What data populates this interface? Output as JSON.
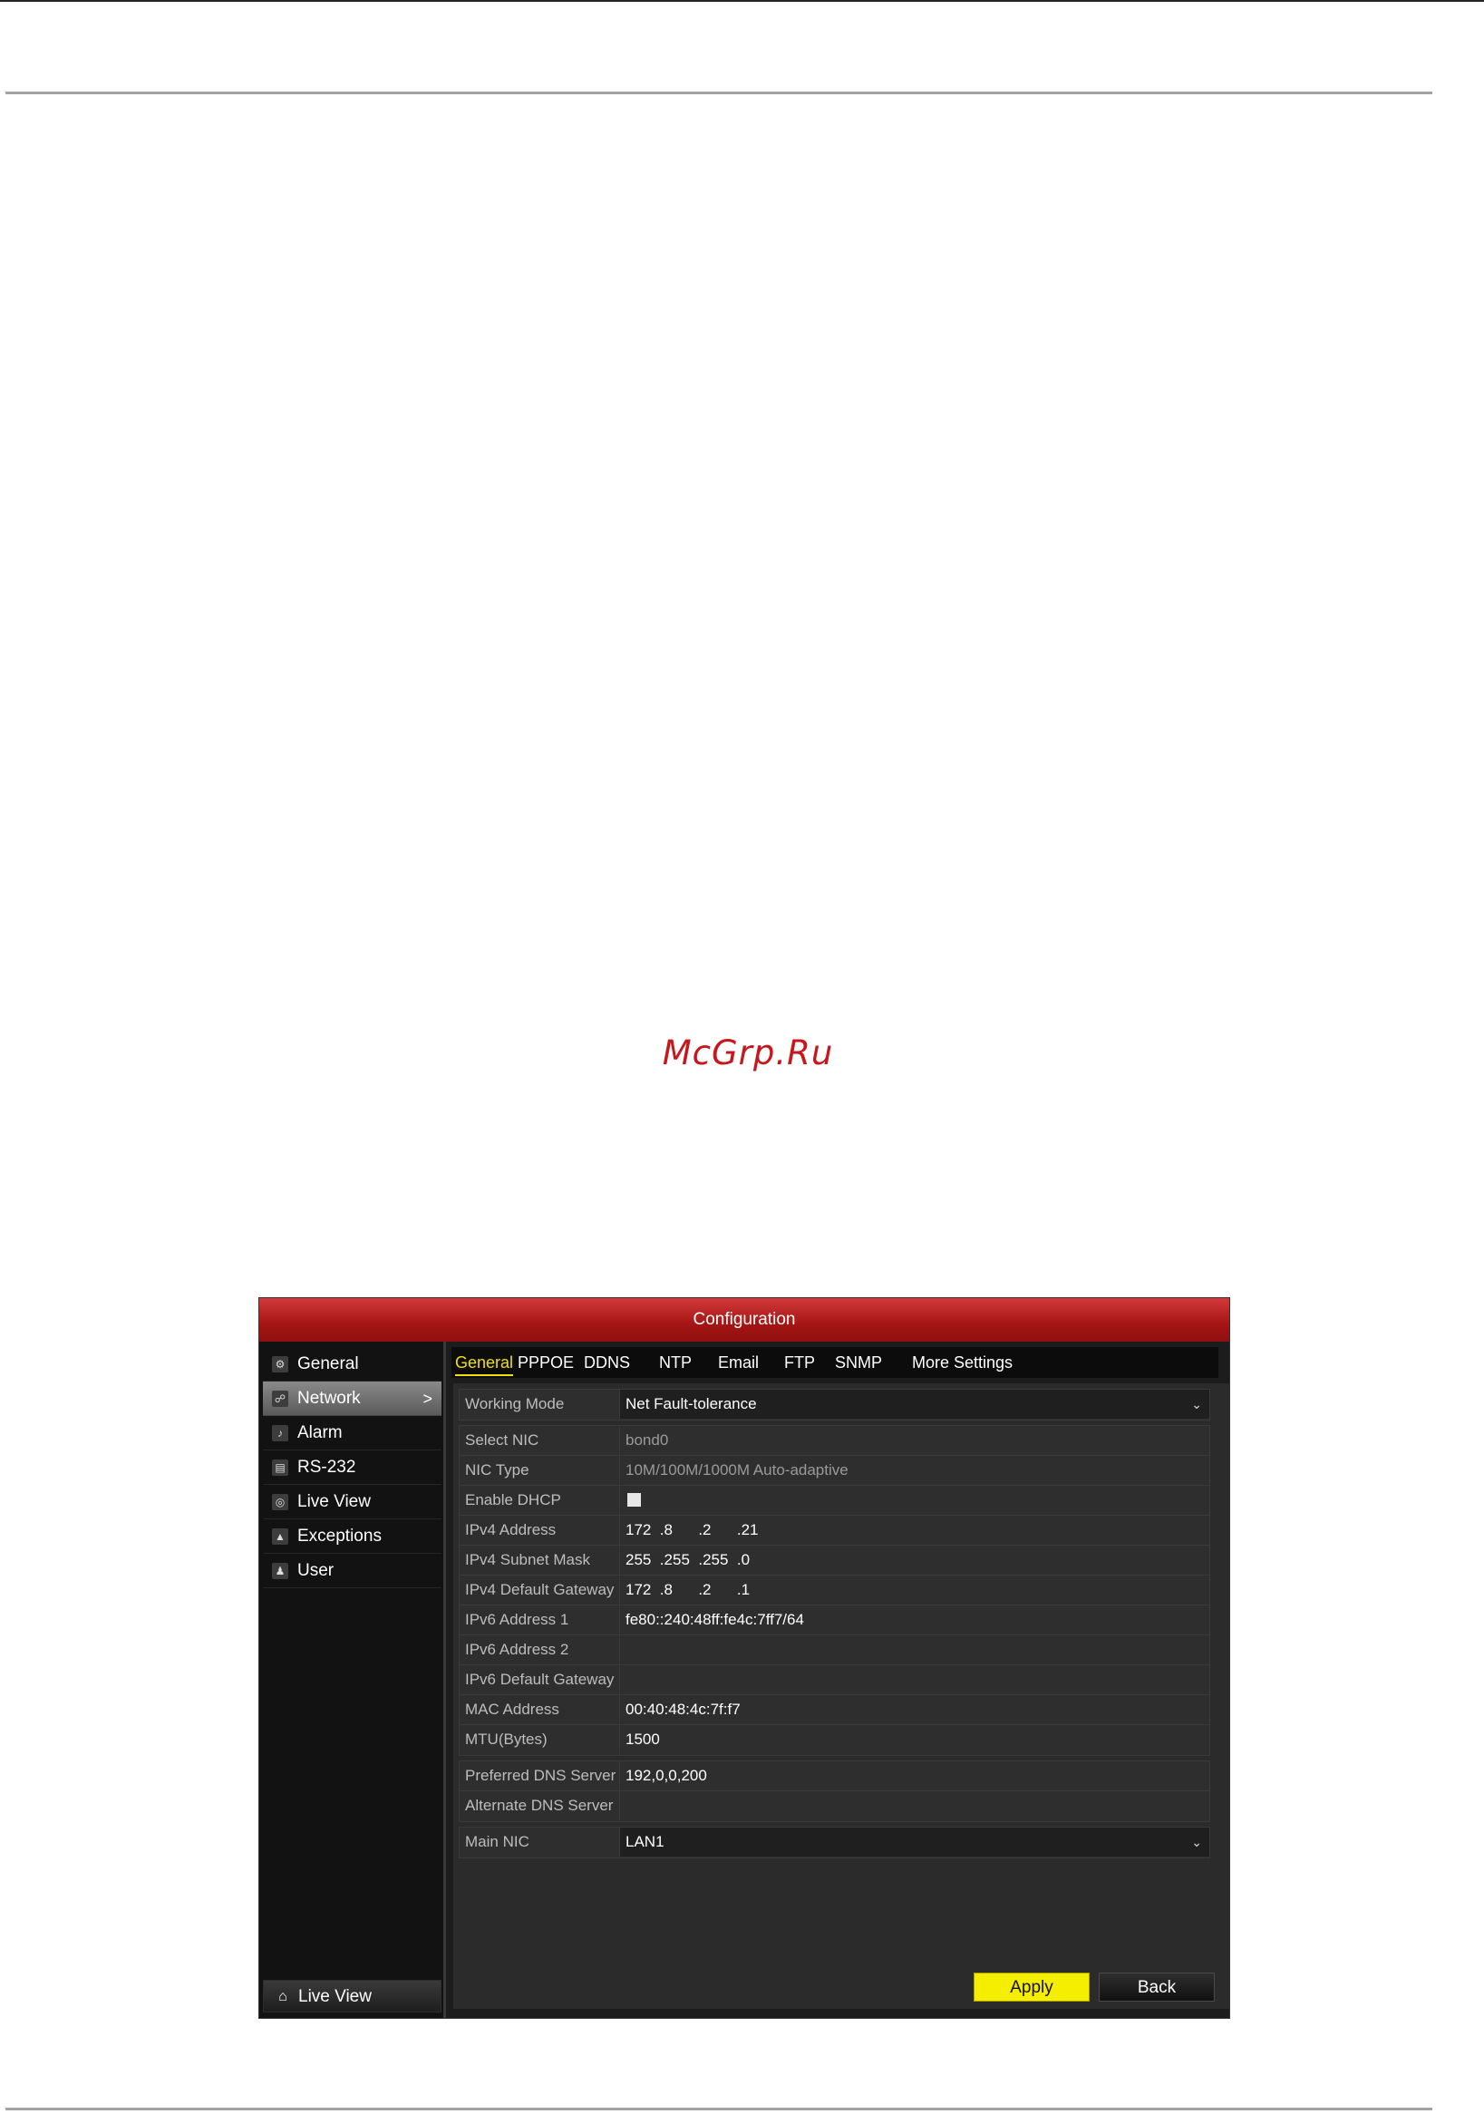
{
  "watermark": "McGrp.Ru",
  "window": {
    "title": "Configuration"
  },
  "sidebar": {
    "items": [
      {
        "label": "General",
        "icon": "gear-icon"
      },
      {
        "label": "Network",
        "icon": "network-icon",
        "active": true
      },
      {
        "label": "Alarm",
        "icon": "alarm-bell-icon"
      },
      {
        "label": "RS-232",
        "icon": "serial-port-icon"
      },
      {
        "label": "Live View",
        "icon": "eye-icon"
      },
      {
        "label": "Exceptions",
        "icon": "warning-icon"
      },
      {
        "label": "User",
        "icon": "users-icon"
      }
    ],
    "active_arrow": ">",
    "bottom": {
      "label": "Live View",
      "icon": "home-icon"
    }
  },
  "tabs": [
    {
      "label": "General",
      "active": true
    },
    {
      "label": "PPPOE"
    },
    {
      "label": "DDNS"
    },
    {
      "label": "NTP"
    },
    {
      "label": "Email"
    },
    {
      "label": "FTP"
    },
    {
      "label": "SNMP"
    },
    {
      "label": "More Settings"
    }
  ],
  "form": {
    "working_mode": {
      "label": "Working Mode",
      "value": "Net Fault-tolerance"
    },
    "select_nic": {
      "label": "Select NIC",
      "value": "bond0"
    },
    "nic_type": {
      "label": "NIC Type",
      "value": "10M/100M/1000M Auto-adaptive"
    },
    "enable_dhcp": {
      "label": "Enable DHCP",
      "checked": false
    },
    "ipv4_address": {
      "label": "IPv4 Address",
      "value": "172  .8      .2      .21"
    },
    "ipv4_subnet_mask": {
      "label": "IPv4 Subnet Mask",
      "value": "255  .255  .255  .0"
    },
    "ipv4_default_gateway": {
      "label": "IPv4 Default Gateway",
      "value": "172  .8      .2      .1"
    },
    "ipv6_address_1": {
      "label": "IPv6 Address 1",
      "value": "fe80::240:48ff:fe4c:7ff7/64"
    },
    "ipv6_address_2": {
      "label": "IPv6 Address 2",
      "value": ""
    },
    "ipv6_default_gateway": {
      "label": "IPv6 Default Gateway",
      "value": ""
    },
    "mac_address": {
      "label": "MAC Address",
      "value": "00:40:48:4c:7f:f7"
    },
    "mtu": {
      "label": "MTU(Bytes)",
      "value": "1500"
    },
    "preferred_dns": {
      "label": "Preferred DNS Server",
      "value": "192,0,0,200"
    },
    "alternate_dns": {
      "label": "Alternate DNS Server",
      "value": ""
    },
    "main_nic": {
      "label": "Main NIC",
      "value": "LAN1"
    }
  },
  "buttons": {
    "apply": "Apply",
    "back": "Back"
  },
  "colors": {
    "accent_tab": "#f0e000",
    "apply_button": "#f5ee00",
    "title_bar": "#b01c1c"
  }
}
